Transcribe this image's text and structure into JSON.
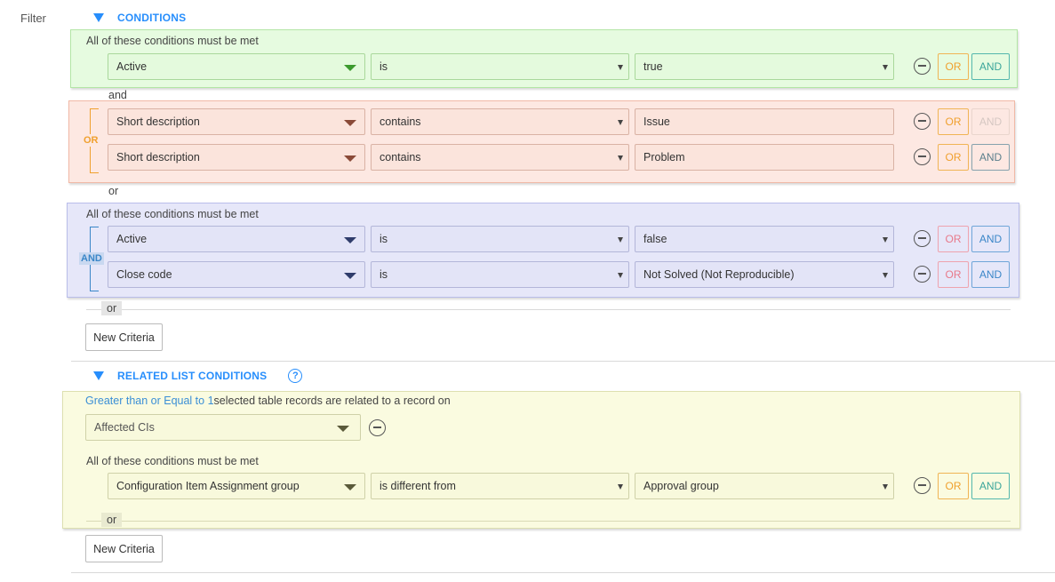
{
  "filter_label": "Filter",
  "conditions": {
    "title": "CONDITIONS",
    "block1": {
      "caption": "All of these conditions must be met",
      "row": {
        "field": "Active",
        "operator": "is",
        "value": "true"
      }
    },
    "connector_and": "and",
    "block2": {
      "bracket_tag": "OR",
      "rows": [
        {
          "field": "Short description",
          "operator": "contains",
          "value": "Issue"
        },
        {
          "field": "Short description",
          "operator": "contains",
          "value": "Problem"
        }
      ]
    },
    "connector_or": "or",
    "block3": {
      "caption": "All of these conditions must be met",
      "bracket_tag": "AND",
      "rows": [
        {
          "field": "Active",
          "operator": "is",
          "value": "false"
        },
        {
          "field": "Close code",
          "operator": "is",
          "value": "Not Solved (Not Reproducible)"
        }
      ]
    },
    "or_tag": "or",
    "new_criteria": "New Criteria"
  },
  "related": {
    "title": "RELATED LIST CONDITIONS",
    "help_glyph": "?",
    "quantity_link": "Greater than or Equal to 1",
    "quantity_text": "selected table records are related to a record on",
    "related_list": "Affected CIs",
    "caption": "All of these conditions must be met",
    "row": {
      "field": "Configuration Item Assignment group",
      "operator": "is different from",
      "value": "Approval group"
    },
    "or_tag": "or",
    "new_criteria": "New Criteria"
  },
  "buttons": {
    "or_label": "OR",
    "and_label": "AND"
  },
  "colors": {
    "accent_blue": "#278efc",
    "or_orange": "#f0a02e",
    "or_red": "#e8798a",
    "and_teal": "#3aa59a",
    "and_blue": "#3a86c8"
  },
  "icons": {
    "collapse": "triangle-down-icon",
    "remove": "minus-circle-icon",
    "help": "help-circle-icon",
    "dropdown": "caret-down-icon"
  }
}
